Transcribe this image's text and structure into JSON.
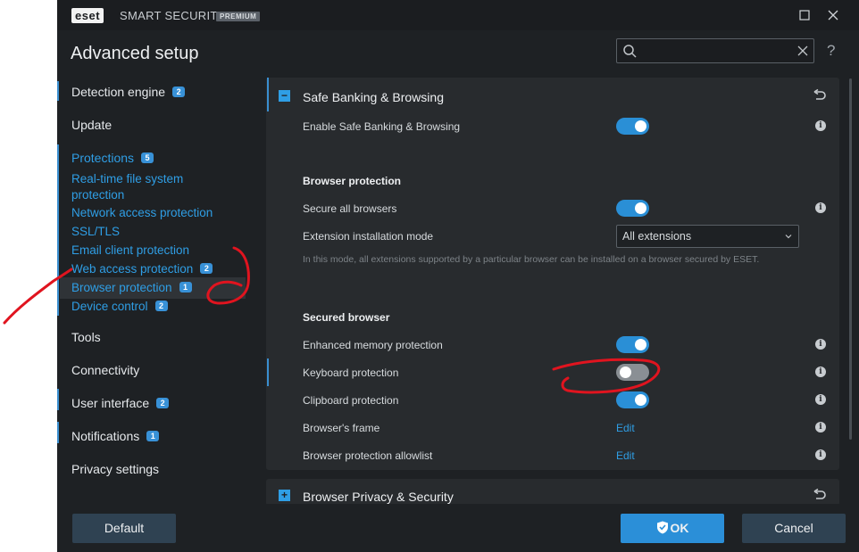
{
  "window": {
    "logo": "eset",
    "app_name": "SMART SECURITY",
    "edition_badge": "PREMIUM",
    "maximize_icon": "maximize-icon",
    "close_icon": "close-icon"
  },
  "header": {
    "title": "Advanced setup",
    "search": {
      "value": "",
      "placeholder": ""
    },
    "help": "?"
  },
  "sidebar": {
    "items": [
      {
        "label": "Detection engine",
        "badge": "2"
      },
      {
        "label": "Update",
        "badge": ""
      },
      {
        "label": "Protections",
        "badge": "5"
      },
      {
        "label": "Tools",
        "badge": ""
      },
      {
        "label": "Connectivity",
        "badge": ""
      },
      {
        "label": "User interface",
        "badge": "2"
      },
      {
        "label": "Notifications",
        "badge": "1"
      },
      {
        "label": "Privacy settings",
        "badge": ""
      }
    ],
    "protections_sub": [
      {
        "label": "Real-time file system protection",
        "badge": ""
      },
      {
        "label": "Network access protection",
        "badge": ""
      },
      {
        "label": "SSL/TLS",
        "badge": ""
      },
      {
        "label": "Email client protection",
        "badge": ""
      },
      {
        "label": "Web access protection",
        "badge": "2"
      },
      {
        "label": "Browser protection",
        "badge": "1",
        "selected": true
      },
      {
        "label": "Device control",
        "badge": "2"
      }
    ]
  },
  "main": {
    "section1": {
      "title": "Safe Banking & Browsing",
      "expand_symbol": "−",
      "enable_label": "Enable Safe Banking & Browsing",
      "enable_on": true,
      "browser_protection_heading": "Browser protection",
      "secure_all_label": "Secure all browsers",
      "secure_all_on": true,
      "ext_mode_label": "Extension installation mode",
      "ext_mode_value": "All extensions",
      "ext_mode_hint": "In this mode, all extensions supported by a particular browser can be installed on a browser secured by ESET.",
      "secured_browser_heading": "Secured browser",
      "enhanced_memory_label": "Enhanced memory protection",
      "enhanced_memory_on": true,
      "keyboard_label": "Keyboard protection",
      "keyboard_on": false,
      "clipboard_label": "Clipboard protection",
      "clipboard_on": true,
      "frame_label": "Browser's frame",
      "frame_action": "Edit",
      "allowlist_label": "Browser protection allowlist",
      "allowlist_action": "Edit",
      "info_symbol": "i"
    },
    "section2": {
      "title": "Browser Privacy & Security",
      "expand_symbol": "+"
    }
  },
  "footer": {
    "default_label": "Default",
    "ok_label": "OK",
    "cancel_label": "Cancel"
  },
  "colors": {
    "accent": "#2f9ee5",
    "toggle_on": "#2a8fd6",
    "annotation": "#e0141f"
  }
}
